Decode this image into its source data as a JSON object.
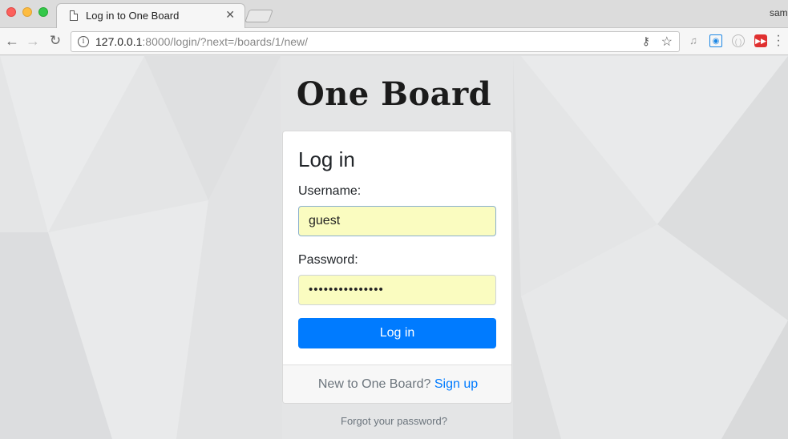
{
  "browser": {
    "tab_title": "Log in to One Board",
    "user_label": "sam",
    "url_host": "127.0.0.1",
    "url_rest": ":8000/login/?next=/boards/1/new/"
  },
  "page": {
    "brand": "One Board",
    "login_title": "Log in",
    "username_label": "Username:",
    "username_value": "guest",
    "password_label": "Password:",
    "password_value": "•••••••••••••••",
    "submit_label": "Log in",
    "signup_prompt": "New to One Board?",
    "signup_link": "Sign up",
    "forgot_link": "Forgot your password?"
  },
  "colors": {
    "primary": "#007bff",
    "autofill": "#fafcc0",
    "background": "#e4e5e6"
  }
}
